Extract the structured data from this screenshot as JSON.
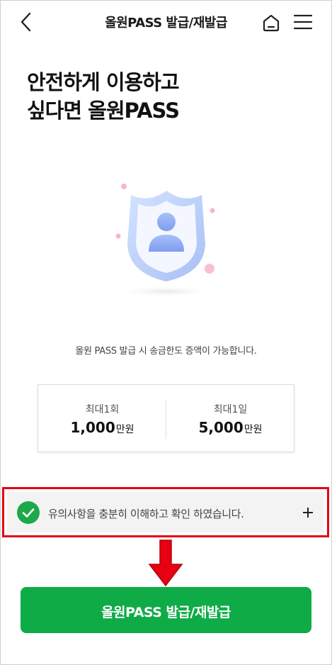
{
  "header": {
    "title": "올원PASS 발급/재발급",
    "back_icon": "chevron-left-icon",
    "home_icon": "home-icon",
    "menu_icon": "hamburger-menu-icon"
  },
  "main": {
    "headline_line1": "안전하게 이용하고",
    "headline_line2": "싶다면 올원PASS",
    "illustration": "shield-user-icon",
    "description": "올원 PASS 발급 시 송금한도 증액이 가능합니다."
  },
  "limits": {
    "per_time_label": "최대1회",
    "per_time_value": "1,000",
    "per_time_unit": "만원",
    "per_day_label": "최대1일",
    "per_day_value": "5,000",
    "per_day_unit": "만원"
  },
  "notice": {
    "text": "유의사항을 충분히 이해하고 확인 하였습니다.",
    "checked": true,
    "expand_icon": "plus-icon"
  },
  "cta": {
    "label": "올원PASS 발급/재발급"
  },
  "colors": {
    "primary": "#0fab47",
    "check": "#1ea84a",
    "highlight": "#e60012"
  }
}
